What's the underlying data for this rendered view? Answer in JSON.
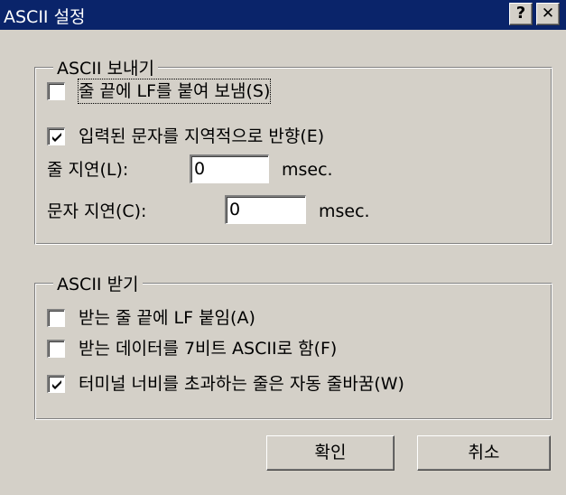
{
  "window": {
    "title": "ASCII 설정",
    "help_glyph": "?",
    "close_glyph": "✕"
  },
  "send_group": {
    "legend": "ASCII 보내기",
    "append_lf": {
      "label": "줄 끝에 LF를 붙여 보냄(S)",
      "checked": false
    },
    "echo_local": {
      "label": "입력된 문자를 지역적으로 반향(E)",
      "checked": true
    },
    "line_delay": {
      "label": "줄 지연(L):",
      "value": "0",
      "unit": "msec."
    },
    "char_delay": {
      "label": "문자 지연(C):",
      "value": "0",
      "unit": "msec."
    }
  },
  "receive_group": {
    "legend": "ASCII 받기",
    "append_lf": {
      "label": "받는 줄 끝에 LF 붙임(A)",
      "checked": false
    },
    "force_7bit": {
      "label": "받는 데이터를 7비트 ASCII로 함(F)",
      "checked": false
    },
    "wrap_lines": {
      "label": "터미널 너비를 초과하는 줄은 자동 줄바꿈(W)",
      "checked": true
    }
  },
  "buttons": {
    "ok": "확인",
    "cancel": "취소"
  }
}
